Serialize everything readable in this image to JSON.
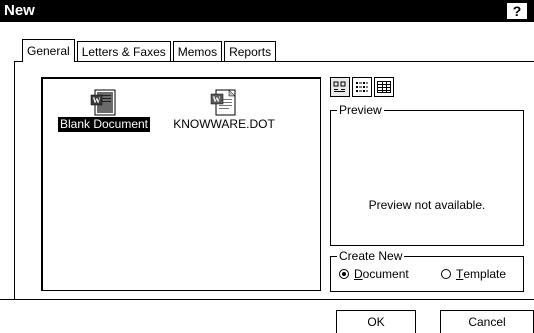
{
  "window": {
    "title": "New",
    "help_label": "?"
  },
  "tabs": [
    {
      "label": "General",
      "active": true
    },
    {
      "label": "Letters & Faxes",
      "active": false
    },
    {
      "label": "Memos",
      "active": false
    },
    {
      "label": "Reports",
      "active": false
    }
  ],
  "files": [
    {
      "label": "Blank Document",
      "icon": "word-document-icon",
      "selected": true
    },
    {
      "label": "KNOWWARE.DOT",
      "icon": "word-template-icon",
      "selected": false
    }
  ],
  "view_buttons": [
    {
      "icon": "large-icons-view-icon",
      "active": true
    },
    {
      "icon": "list-view-icon",
      "active": false
    },
    {
      "icon": "details-view-icon",
      "active": false
    }
  ],
  "preview": {
    "group_label": "Preview",
    "message": "Preview not available."
  },
  "create_new": {
    "group_label": "Create New",
    "options": [
      {
        "label": "Document",
        "mnemonic": "D",
        "rest": "ocument",
        "checked": true
      },
      {
        "label": "Template",
        "mnemonic": "T",
        "rest": "emplate",
        "checked": false
      }
    ]
  },
  "buttons": {
    "ok": "OK",
    "cancel": "Cancel"
  }
}
